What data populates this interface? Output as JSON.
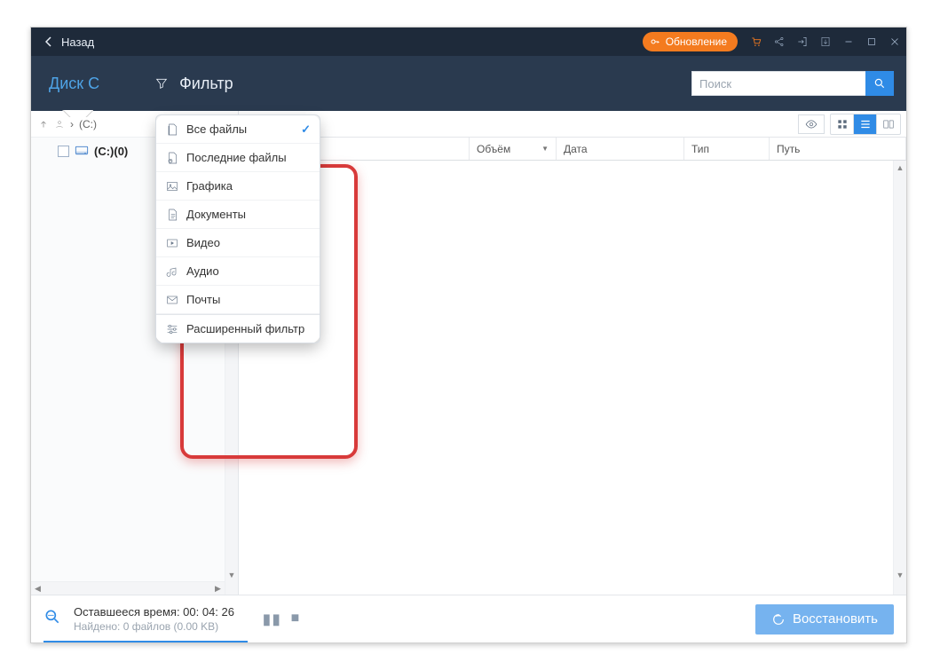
{
  "titlebar": {
    "back_label": "Назад",
    "update_label": "Обновление"
  },
  "subheader": {
    "disk_label": "Диск C",
    "filter_label": "Фильтр",
    "search_placeholder": "Поиск"
  },
  "path": {
    "text": "(C:)"
  },
  "tree": {
    "items": [
      {
        "label": "(C:)(0)"
      }
    ]
  },
  "columns": {
    "name": "",
    "size": "Объём",
    "date": "Дата",
    "type": "Тип",
    "path": "Путь"
  },
  "filter_menu": {
    "items": [
      {
        "label": "Все файлы",
        "selected": true
      },
      {
        "label": "Последние файлы"
      },
      {
        "label": "Графика"
      },
      {
        "label": "Документы"
      },
      {
        "label": "Видео"
      },
      {
        "label": "Аудио"
      },
      {
        "label": "Почты"
      },
      {
        "label": "Расширенный фильтр"
      }
    ]
  },
  "footer": {
    "remaining_label": "Оставшееся время: 00: 04: 26",
    "found_label": "Найдено: 0 файлов (0.00 KB)",
    "recover_label": "Восстановить"
  },
  "colors": {
    "accent": "#2f8be6",
    "header_dark": "#1e2a3a",
    "subheader": "#2a3a4f",
    "highlight_border": "#d83a3a",
    "update_pill": "#f47b1f"
  }
}
